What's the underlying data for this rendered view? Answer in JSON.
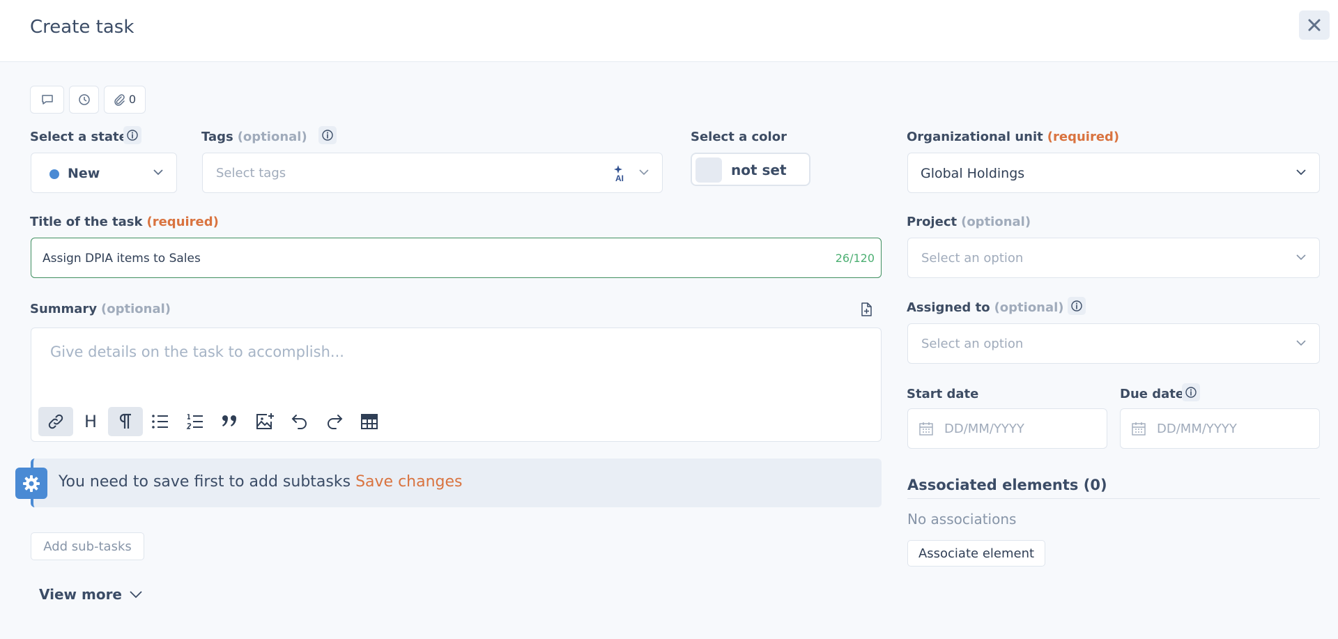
{
  "header": {
    "title": "Create task"
  },
  "actions": {
    "attachments_count": "0"
  },
  "state": {
    "label": "Select a state",
    "value": "New",
    "dot_color": "#4a8ad4"
  },
  "tags": {
    "label": "Tags",
    "optional": "(optional)",
    "placeholder": "Select tags",
    "ai_badge": "AI"
  },
  "color": {
    "label": "Select a color",
    "value": "not set"
  },
  "org_unit": {
    "label": "Organizational unit",
    "required": "(required)",
    "value": "Global Holdings"
  },
  "title_field": {
    "label": "Title of the task",
    "required": "(required)",
    "value": "Assign DPIA items to Sales",
    "counter": "26/120"
  },
  "project": {
    "label": "Project",
    "optional": "(optional)",
    "placeholder": "Select an option"
  },
  "summary": {
    "label": "Summary",
    "optional": "(optional)",
    "placeholder": "Give details on the task to accomplish...",
    "heading_button": "H"
  },
  "assigned": {
    "label": "Assigned to",
    "optional": "(optional)",
    "placeholder": "Select an option"
  },
  "start_date": {
    "label": "Start date",
    "placeholder": "DD/MM/YYYY"
  },
  "due_date": {
    "label": "Due date",
    "placeholder": "DD/MM/YYYY"
  },
  "banner": {
    "text": "You need to save first to add subtasks",
    "link": "Save changes"
  },
  "subtasks": {
    "button": "Add sub-tasks"
  },
  "view_more": {
    "label": "View more"
  },
  "associations": {
    "title": "Associated elements (0)",
    "empty": "No associations",
    "button": "Associate element"
  },
  "colors": {
    "accent": "#4a8ad4",
    "required": "#d9733f",
    "valid_border": "#3f8f5f",
    "counter": "#4caf72"
  }
}
